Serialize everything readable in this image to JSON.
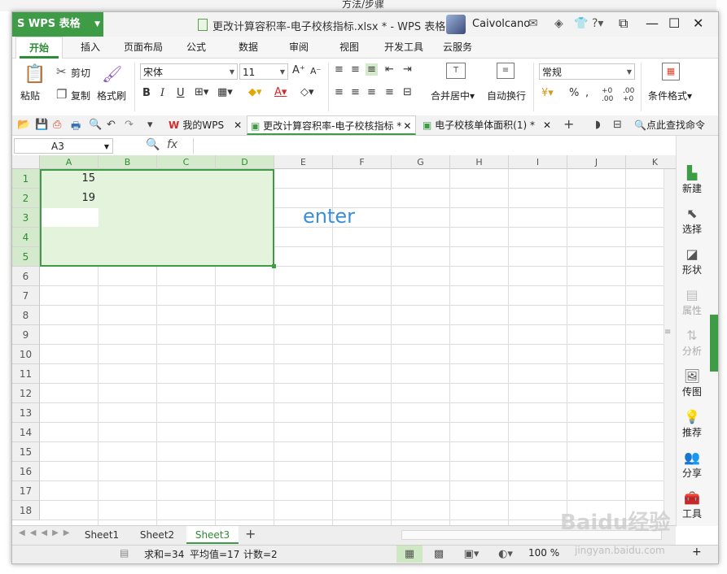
{
  "background": {
    "top_text": "方法/步骤"
  },
  "titlebar": {
    "app_button": "WPS 表格",
    "doc_title": "更改计算容积率-电子校核指标.xlsx * - WPS 表格",
    "user_name": "Caivolcano"
  },
  "ribbon_tabs": [
    "开始",
    "插入",
    "页面布局",
    "公式",
    "数据",
    "审阅",
    "视图",
    "开发工具",
    "云服务"
  ],
  "ribbon": {
    "paste": "粘贴",
    "cut": "剪切",
    "copy": "复制",
    "format_painter": "格式刷",
    "font_name": "宋体",
    "font_size": "11",
    "merge_center": "合并居中",
    "wrap_text": "自动换行",
    "number_format": "常规",
    "conditional_format": "条件格式"
  },
  "doc_tabs": {
    "my_wps": "我的WPS",
    "active": "更改计算容积率-电子校核指标 *",
    "other": "电子校核单体面积(1) *",
    "search": "点此查找命令"
  },
  "formula_bar": {
    "cell_ref": "A3",
    "fx": "fx",
    "content": ""
  },
  "grid": {
    "columns": [
      "A",
      "B",
      "C",
      "D",
      "E",
      "F",
      "G",
      "H",
      "I",
      "J",
      "K"
    ],
    "rows": [
      "1",
      "2",
      "3",
      "4",
      "5",
      "6",
      "7",
      "8",
      "9",
      "10",
      "11",
      "12",
      "13",
      "14",
      "15",
      "16",
      "17",
      "18"
    ],
    "cells": {
      "A1": "15",
      "A2": "19"
    },
    "annotation": "enter"
  },
  "sidebar": {
    "items": [
      "新建",
      "选择",
      "形状",
      "属性",
      "分析",
      "传图",
      "推荐",
      "分享",
      "工具"
    ]
  },
  "sheets": {
    "tabs": [
      "Sheet1",
      "Sheet2",
      "Sheet3"
    ],
    "active": "Sheet3"
  },
  "status": {
    "sum": "求和=34",
    "avg": "平均值=17",
    "count": "计数=2",
    "zoom": "100 %"
  },
  "watermark": {
    "main": "Baidu经验",
    "sub": "jingyan.baidu.com"
  },
  "colors": {
    "accent": "#3e9b46",
    "selection_fill": "#e3f3dc",
    "annotation": "#3a8fd8"
  }
}
